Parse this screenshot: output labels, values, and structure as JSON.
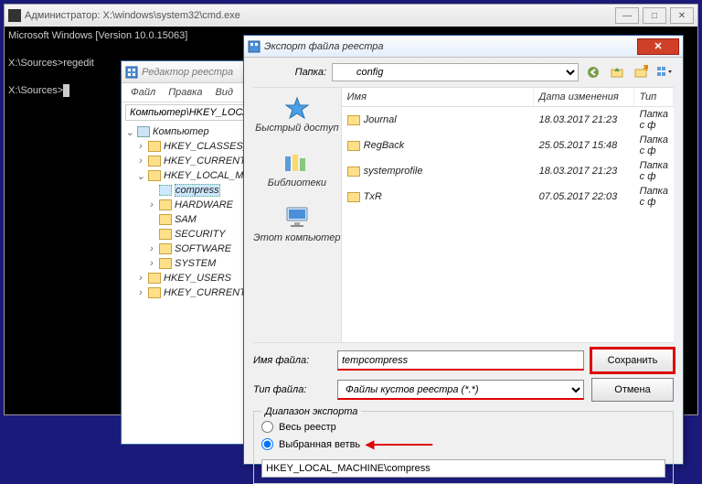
{
  "cmd": {
    "title": "Администратор: X:\\windows\\system32\\cmd.exe",
    "line1": "Microsoft Windows [Version 10.0.15063]",
    "line2": "X:\\Sources>regedit",
    "line3": "X:\\Sources>"
  },
  "regedit": {
    "title": "Редактор реестра",
    "menu": [
      "Файл",
      "Правка",
      "Вид"
    ],
    "address": "Компьютер\\HKEY_LOCAL_MACHINE\\compress",
    "tree": {
      "root": "Компьютер",
      "items": [
        "HKEY_CLASSES_ROOT",
        "HKEY_CURRENT_USER",
        "HKEY_LOCAL_MACHINE"
      ],
      "hklm_children": [
        "compress",
        "HARDWARE",
        "SAM",
        "SECURITY",
        "SOFTWARE",
        "SYSTEM"
      ],
      "after": [
        "HKEY_USERS",
        "HKEY_CURRENT_CONFIG"
      ]
    }
  },
  "dialog": {
    "title": "Экспорт файла реестра",
    "folder_label": "Папка:",
    "folder_value": "config",
    "places": [
      {
        "label": "Быстрый доступ",
        "icon": "star"
      },
      {
        "label": "Библиотеки",
        "icon": "libs"
      },
      {
        "label": "Этот компьютер",
        "icon": "pc"
      }
    ],
    "columns": {
      "name": "Имя",
      "date": "Дата изменения",
      "type": "Тип"
    },
    "files": [
      {
        "name": "Journal",
        "date": "18.03.2017 21:23",
        "type": "Папка с ф"
      },
      {
        "name": "RegBack",
        "date": "25.05.2017 15:48",
        "type": "Папка с ф"
      },
      {
        "name": "systemprofile",
        "date": "18.03.2017 21:23",
        "type": "Папка с ф"
      },
      {
        "name": "TxR",
        "date": "07.05.2017 22:03",
        "type": "Папка с ф"
      }
    ],
    "filename_label": "Имя файла:",
    "filename_value": "tempcompress",
    "filetype_label": "Тип файла:",
    "filetype_value": "Файлы кустов реестра (*.*)",
    "save_label": "Сохранить",
    "cancel_label": "Отмена",
    "scope": {
      "legend": "Диапазон экспорта",
      "all_label": "Весь реестр",
      "branch_label": "Выбранная ветвь",
      "branch_value": "HKEY_LOCAL_MACHINE\\compress"
    }
  }
}
